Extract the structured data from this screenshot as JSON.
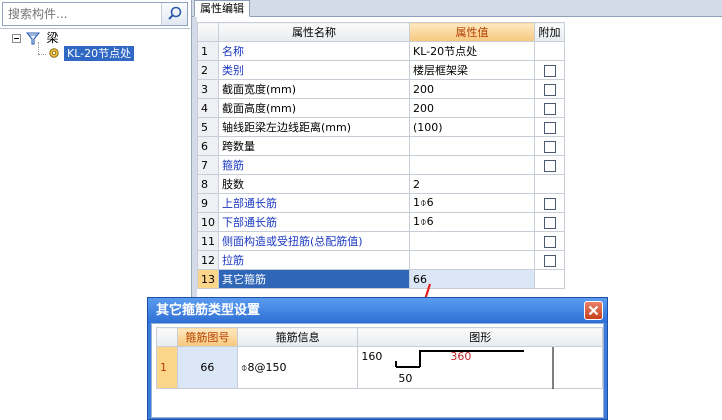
{
  "search": {
    "placeholder": "搜索构件..."
  },
  "tree": {
    "root_label": "梁",
    "child_label": "KL-20节点处"
  },
  "tabs": [
    {
      "label": "属性编辑"
    }
  ],
  "grid": {
    "columns": [
      "属性名称",
      "属性值",
      "附加"
    ],
    "rows": [
      {
        "num": "1",
        "name": "名称",
        "value": "KL-20节点处",
        "checkbox": false,
        "blue": true
      },
      {
        "num": "2",
        "name": "类别",
        "value": "楼层框架梁",
        "checkbox": true,
        "blue": true
      },
      {
        "num": "3",
        "name": "截面宽度(mm)",
        "value": "200",
        "checkbox": true,
        "blue": false
      },
      {
        "num": "4",
        "name": "截面高度(mm)",
        "value": "200",
        "checkbox": true,
        "blue": false
      },
      {
        "num": "5",
        "name": "轴线距梁左边线距离(mm)",
        "value": "(100)",
        "checkbox": true,
        "blue": false
      },
      {
        "num": "6",
        "name": "跨数量",
        "value": "",
        "checkbox": true,
        "blue": false
      },
      {
        "num": "7",
        "name": "箍筋",
        "value": "",
        "checkbox": true,
        "blue": true
      },
      {
        "num": "8",
        "name": "肢数",
        "value": "2",
        "checkbox": false,
        "blue": false
      },
      {
        "num": "9",
        "name": "上部通长筋",
        "value": "1⌽6",
        "checkbox": true,
        "blue": true
      },
      {
        "num": "10",
        "name": "下部通长筋",
        "value": "1⌽6",
        "checkbox": true,
        "blue": true
      },
      {
        "num": "11",
        "name": "侧面构造或受扭筋(总配筋值)",
        "value": "",
        "checkbox": true,
        "blue": true
      },
      {
        "num": "12",
        "name": "拉筋",
        "value": "",
        "checkbox": true,
        "blue": true
      },
      {
        "num": "13",
        "name": "其它箍筋",
        "value": "66",
        "checkbox": false,
        "blue": false,
        "selected": true
      }
    ]
  },
  "dialog": {
    "title": "其它箍筋类型设置",
    "columns": [
      "箍筋图号",
      "箍筋信息",
      "图形"
    ],
    "rows": [
      {
        "num": "1",
        "code": "66",
        "info": "⌽8@150",
        "shape": {
          "left_dim": "160",
          "top_dim": "360",
          "bottom_dim": "50"
        }
      }
    ]
  },
  "colors": {
    "selection_blue": "#2f66b8",
    "header_orange": "#f6c77d",
    "dialog_title": "#2e6fd4",
    "annotation_red": "#e8231e",
    "label_blue": "#1a38c2"
  },
  "icons": [
    "search-icon",
    "tree-collapse-icon",
    "beam-category-icon",
    "component-gear-icon",
    "close-icon",
    "red-arrow-annotation"
  ]
}
